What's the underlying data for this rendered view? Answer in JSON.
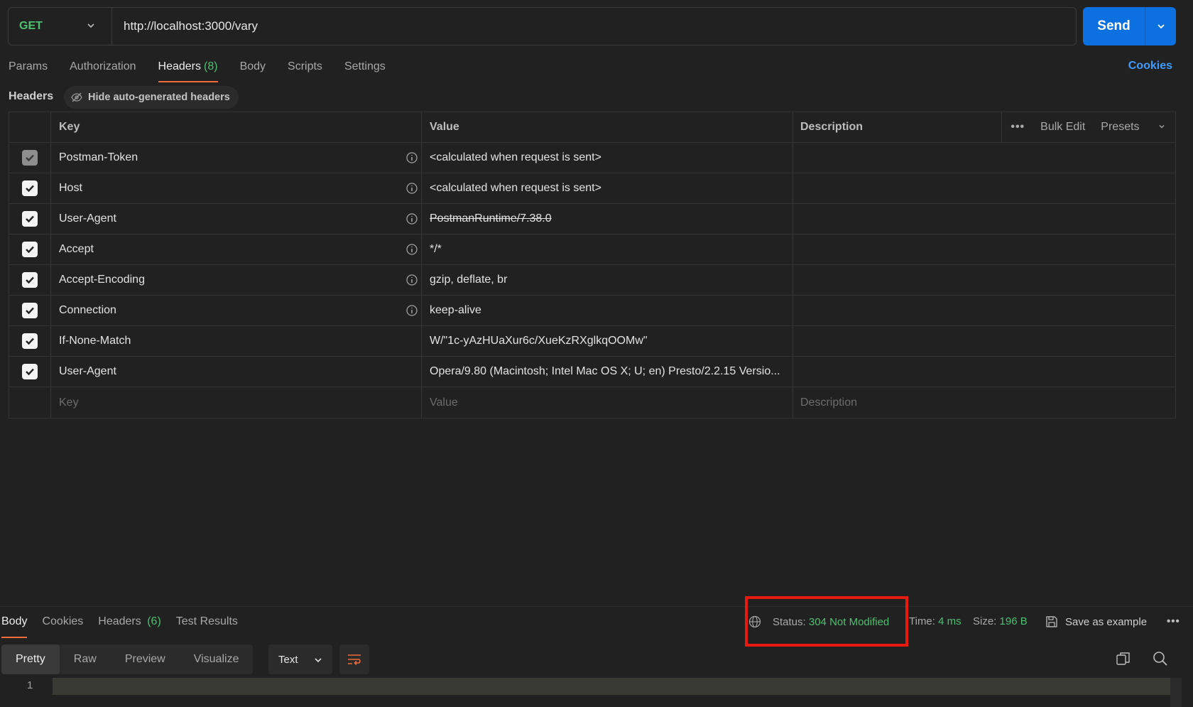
{
  "request": {
    "method": "GET",
    "url": "http://localhost:3000/vary",
    "send_label": "Send"
  },
  "request_tabs": [
    {
      "label": "Params"
    },
    {
      "label": "Authorization"
    },
    {
      "label": "Headers",
      "count": "(8)"
    },
    {
      "label": "Body"
    },
    {
      "label": "Scripts"
    },
    {
      "label": "Settings"
    }
  ],
  "cookies_label": "Cookies",
  "headers_section": {
    "title": "Headers",
    "hide_auto_label": "Hide auto-generated headers"
  },
  "table": {
    "columns": {
      "key": "Key",
      "value": "Value",
      "description": "Description"
    },
    "actions": {
      "bulk_edit": "Bulk Edit",
      "presets": "Presets"
    },
    "rows": [
      {
        "key": "Postman-Token",
        "value": "<calculated when request is sent>"
      },
      {
        "key": "Host",
        "value": "<calculated when request is sent>"
      },
      {
        "key": "User-Agent",
        "value": "PostmanRuntime/7.38.0"
      },
      {
        "key": "Accept",
        "value": "*/*"
      },
      {
        "key": "Accept-Encoding",
        "value": "gzip, deflate, br"
      },
      {
        "key": "Connection",
        "value": "keep-alive"
      },
      {
        "key": "If-None-Match",
        "value": "W/\"1c-yAzHUaXur6c/XueKzRXglkqOOMw\""
      },
      {
        "key": "User-Agent",
        "value": "Opera/9.80 (Macintosh; Intel Mac OS X; U; en) Presto/2.2.15 Versio..."
      }
    ],
    "placeholders": {
      "key": "Key",
      "value": "Value",
      "description": "Description"
    }
  },
  "response": {
    "tabs": [
      {
        "label": "Body"
      },
      {
        "label": "Cookies"
      },
      {
        "label": "Headers",
        "count": "(6)"
      },
      {
        "label": "Test Results"
      }
    ],
    "status_label": "Status:",
    "status_value": "304 Not Modified",
    "time_label": "Time:",
    "time_value": "4 ms",
    "size_label": "Size:",
    "size_value": "196 B",
    "save_example_label": "Save as example",
    "view_modes": [
      "Pretty",
      "Raw",
      "Preview",
      "Visualize"
    ],
    "format": "Text",
    "line_number": "1"
  },
  "colors": {
    "accent_green": "#4fbf72",
    "send_blue": "#0c70e0",
    "active_tab_underline": "#f26b3a",
    "highlight_red": "#e8190f"
  }
}
